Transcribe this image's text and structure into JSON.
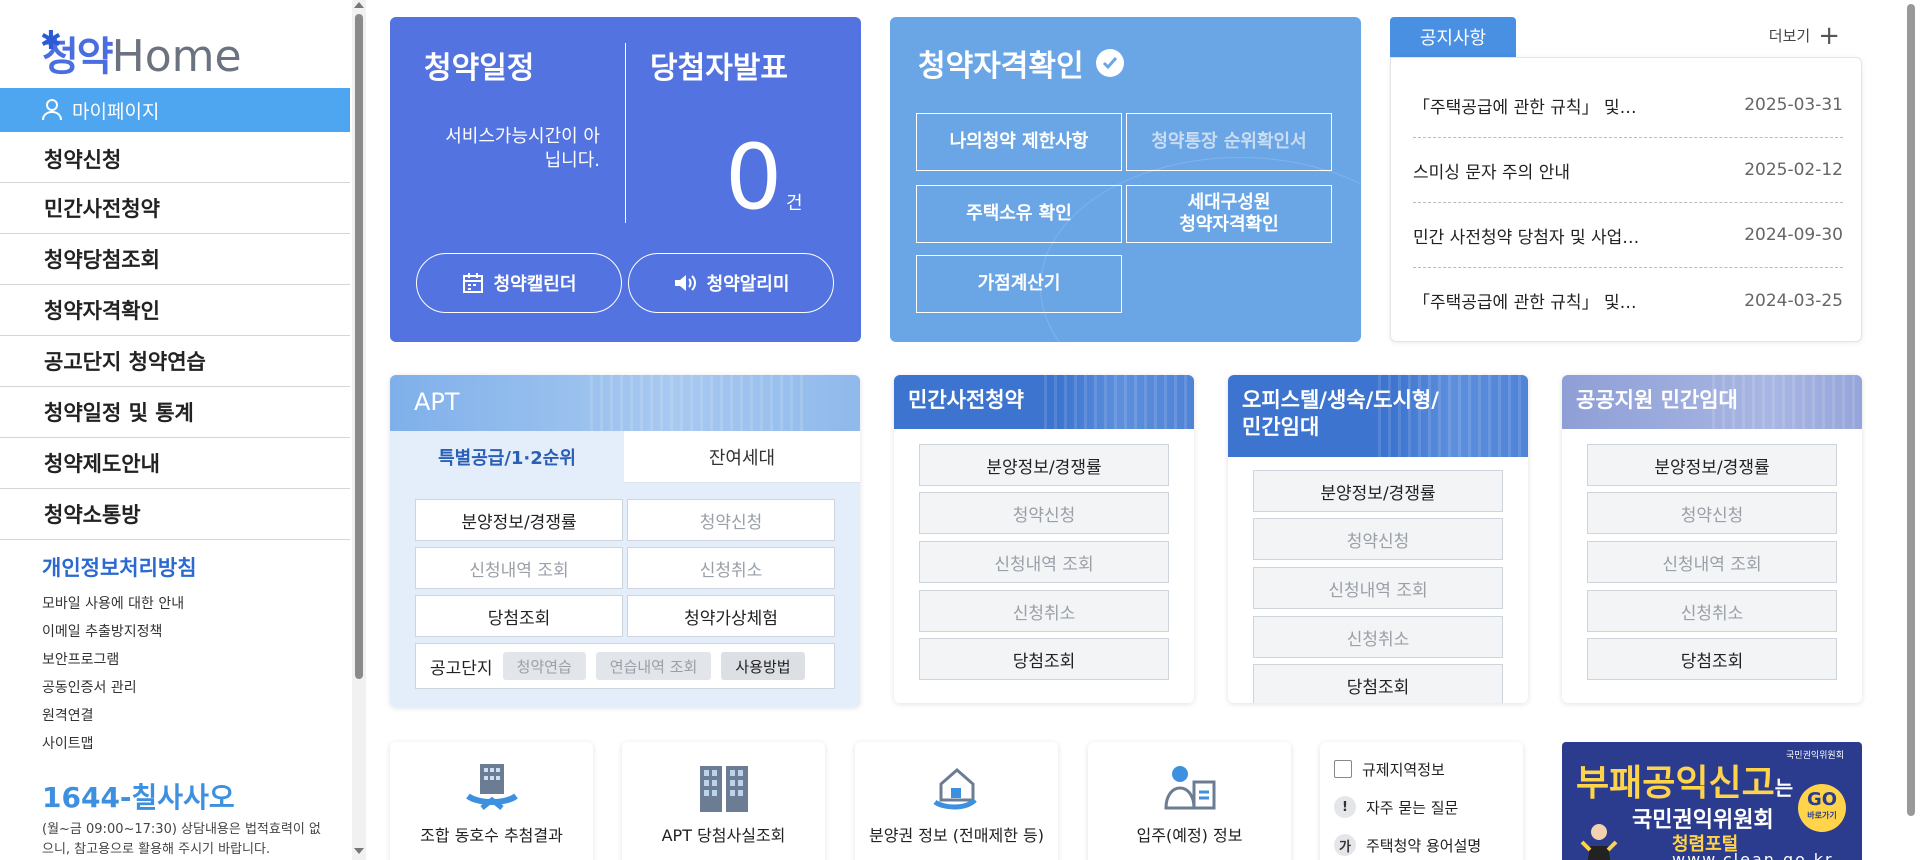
{
  "logo": {
    "ko": "청약",
    "en": "Home"
  },
  "sidebar": {
    "mypage": "마이페이지",
    "menu": [
      "청약신청",
      "민간사전청약",
      "청약당첨조회",
      "청약자격확인",
      "공고단지 청약연습",
      "청약일정 및 통계",
      "청약제도안내",
      "청약소통방"
    ],
    "privacy": "개인정보처리방침",
    "links": [
      "모바일 사용에 대한 안내",
      "이메일 추출방지정책",
      "보안프로그램",
      "공동인증서 관리",
      "원격연결",
      "사이트맵"
    ],
    "phone": "1644-칠사사오",
    "phone_note": "(월~금 09:00~17:30) 상담내용은 법적효력이 없으니, 참고용으로 활용해 주시기 바랍니다."
  },
  "schedule": {
    "title": "청약일정",
    "winner_title": "당첨자발표",
    "service_msg": "서비스가능시간이 아닙니다.",
    "count": "0",
    "unit": "건",
    "calendar_btn": "청약캘린더",
    "alarm_btn": "청약알리미"
  },
  "qual": {
    "title": "청약자격확인",
    "buttons": [
      "나의청약 제한사항",
      "청약통장 순위확인서",
      "주택소유 확인",
      "세대구성원 청약자격확인",
      "가점계산기"
    ],
    "btn4_line1": "세대구성원",
    "btn4_line2": "청약자격확인"
  },
  "notice": {
    "tab": "공지사항",
    "more": "더보기",
    "items": [
      {
        "title": "「주택공급에 관한 규칙」 및…",
        "date": "2025-03-31"
      },
      {
        "title": "스미싱 문자 주의 안내",
        "date": "2025-02-12"
      },
      {
        "title": "민간 사전청약 당첨자 및 사업…",
        "date": "2024-09-30"
      },
      {
        "title": "「주택공급에 관한 규칙」 및…",
        "date": "2024-03-25"
      }
    ]
  },
  "apt": {
    "title": "APT",
    "tab_active": "특별공급/1·2순위",
    "tab_other": "잔여세대",
    "buttons": [
      "분양정보/경쟁률",
      "청약신청",
      "신청내역 조회",
      "신청취소",
      "당첨조회",
      "청약가상체험"
    ],
    "ann_label": "공고단지",
    "chips": [
      "청약연습",
      "연습내역 조회",
      "사용방법"
    ]
  },
  "private": {
    "title": "민간사전청약",
    "buttons": [
      "분양정보/경쟁률",
      "청약신청",
      "신청내역 조회",
      "신청취소",
      "당첨조회"
    ]
  },
  "officetel": {
    "title_line1": "오피스텔/생숙/도시형/",
    "title_line2": "민간임대",
    "buttons": [
      "분양정보/경쟁률",
      "청약신청",
      "신청내역 조회",
      "신청취소",
      "당첨조회"
    ]
  },
  "public": {
    "title": "공공지원 민간임대",
    "buttons": [
      "분양정보/경쟁률",
      "청약신청",
      "신청내역 조회",
      "신청취소",
      "당첨조회"
    ]
  },
  "bottom": {
    "cards": [
      "조합 동호수 추첨결과",
      "APT 당첨사실조회",
      "분양권 정보 (전매제한 등)",
      "입주(예정) 정보"
    ],
    "quick": [
      "규제지역정보",
      "자주 묻는 질문",
      "주택청약 용어설명"
    ],
    "quick_icons": [
      "",
      "!",
      "가"
    ]
  },
  "banner": {
    "big": "부패공익신고",
    "suffix": "는",
    "org": "국민권익위원회",
    "portal": "청렴포털",
    "url": "www.clean.go.kr",
    "go": "GO",
    "go_sub": "바로가기",
    "ministry": "국민권익위원회"
  }
}
